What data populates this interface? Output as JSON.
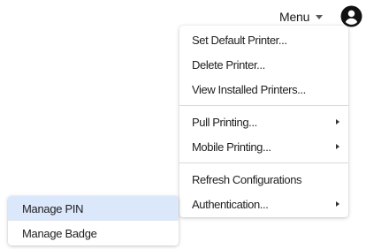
{
  "header": {
    "menu_label": "Menu",
    "caret_icon": "caret-down-icon",
    "account_icon": "account-circle-icon"
  },
  "dropdown": {
    "groups": [
      {
        "items": [
          {
            "label": "Set Default Printer...",
            "has_submenu": false
          },
          {
            "label": "Delete Printer...",
            "has_submenu": false
          },
          {
            "label": "View Installed Printers...",
            "has_submenu": false
          }
        ]
      },
      {
        "items": [
          {
            "label": "Pull Printing...",
            "has_submenu": true
          },
          {
            "label": "Mobile Printing...",
            "has_submenu": true
          }
        ]
      },
      {
        "items": [
          {
            "label": "Refresh Configurations",
            "has_submenu": false
          },
          {
            "label": "Authentication...",
            "has_submenu": true
          }
        ]
      }
    ]
  },
  "submenu": {
    "parent": "Authentication...",
    "items": [
      {
        "label": "Manage PIN",
        "highlighted": true
      },
      {
        "label": "Manage Badge",
        "highlighted": false
      }
    ]
  },
  "colors": {
    "highlight": "#dbe7fb",
    "text": "#1f1f1f",
    "divider": "#d9d9d9"
  }
}
